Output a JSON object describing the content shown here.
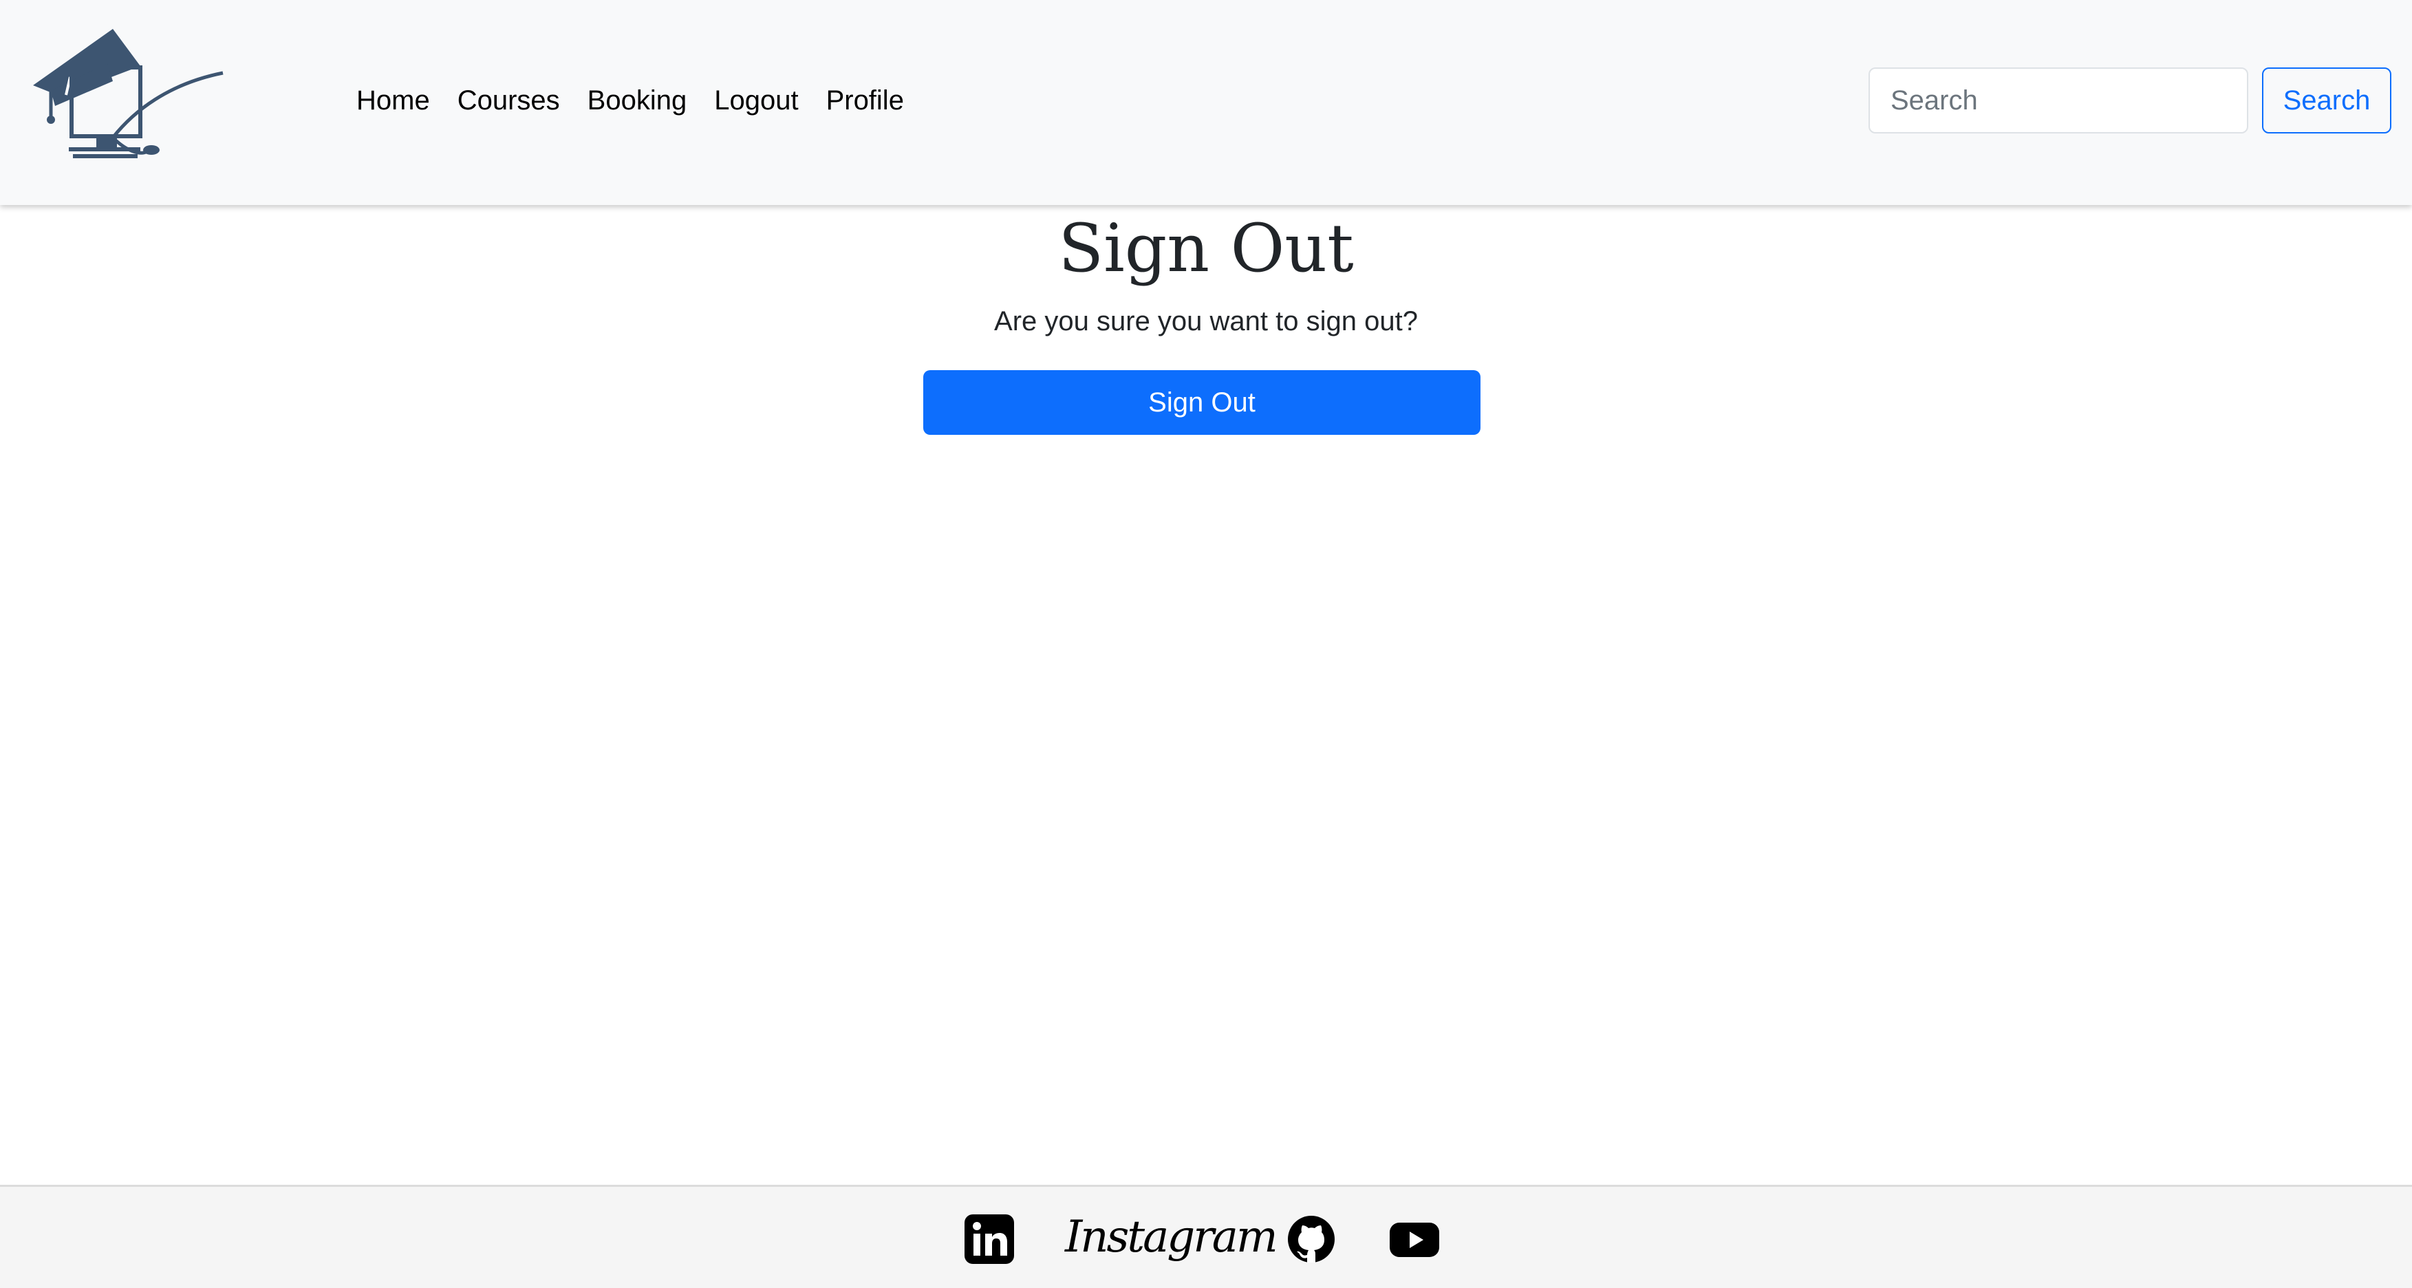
{
  "navbar": {
    "logo_icon": "graduation-cap-computer-logo",
    "links": [
      {
        "label": "Home"
      },
      {
        "label": "Courses"
      },
      {
        "label": "Booking"
      },
      {
        "label": "Logout"
      },
      {
        "label": "Profile"
      }
    ],
    "search": {
      "placeholder": "Search",
      "value": "",
      "button_label": "Search"
    }
  },
  "main": {
    "title": "Sign Out",
    "message": "Are you sure you want to sign out?",
    "button_label": "Sign Out"
  },
  "footer": {
    "icons": [
      "linkedin-icon",
      "instagram-icon",
      "github-icon",
      "youtube-icon"
    ],
    "instagram_label": "Instagram"
  },
  "colors": {
    "primary": "#0d6efd",
    "navbar_bg": "#f8f9fa",
    "footer_bg": "#f5f5f5",
    "logo": "#3d5571",
    "text": "#212529"
  }
}
